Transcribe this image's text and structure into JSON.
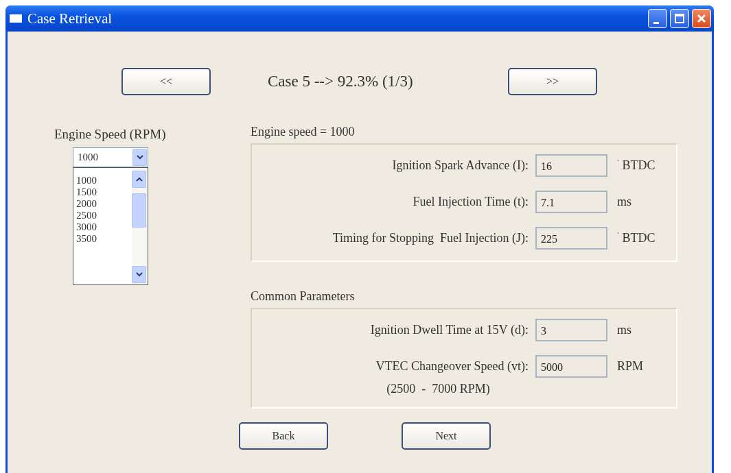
{
  "window": {
    "title": "Case Retrieval"
  },
  "navigation": {
    "previous": "<<",
    "case_label": "Case 5 --> 92.3% (1/3)",
    "next": ">>"
  },
  "engine_speed": {
    "label": "Engine Speed (RPM)",
    "value": "1000",
    "expanded": true,
    "options": [
      "1000",
      "1500",
      "2000",
      "2500",
      "3000",
      "3500"
    ]
  },
  "groups": [
    {
      "title": "Engine speed = 1000",
      "fields": [
        {
          "label": "Ignition Spark Advance (I):",
          "value": "16",
          "unit": "$^{˚}$ BTDC"
        },
        {
          "label": "Fuel Injection Time (t):",
          "value": "7.1",
          "unit": "ms"
        },
        {
          "label": "Timing for Stopping  Fuel Injection (J):",
          "value": "225",
          "unit": "$^{˚}$ BTDC"
        }
      ]
    },
    {
      "title": "Common Parameters",
      "fields": [
        {
          "label": "Ignition Dwell Time at 15V (d):",
          "value": "3",
          "unit": "ms"
        },
        {
          "label": "VTEC Changeover Speed (vt):",
          "value": "5000",
          "unit": "RPM",
          "note": "(2500  -  7000 RPM)"
        }
      ]
    }
  ],
  "buttons": [
    "Back",
    "Next"
  ]
}
